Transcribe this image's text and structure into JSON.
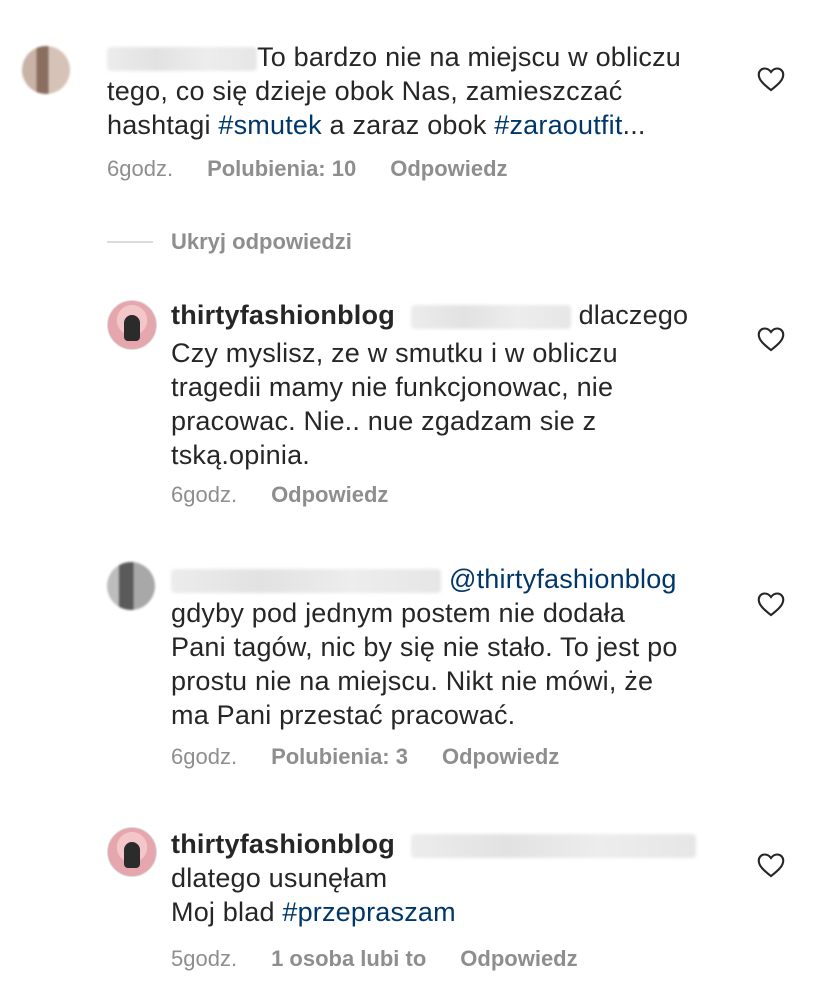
{
  "comments": [
    {
      "line1": "To bardzo nie na miejscu w obliczu",
      "line2": "tego, co się dzieje obok Nas, zamieszczać",
      "line3_prefix": "hashtagi ",
      "hashtag1": "#smutek",
      "line3_mid": " a zaraz obok ",
      "hashtag2": "#zaraoutfit",
      "line3_suffix": "...",
      "time": "6godz.",
      "likes": "Polubienia: 10",
      "reply": "Odpowiedz"
    },
    {
      "username": "thirtyfashionblog",
      "line1_tail": "dlaczego",
      "line2": "Czy myslisz, ze w smutku i w obliczu",
      "line3": "tragedii mamy nie funkcjonowac, nie",
      "line4": "pracowac. Nie.. nue zgadzam sie z",
      "line5": "tską.opinia.",
      "time": "6godz.",
      "reply": "Odpowiedz"
    },
    {
      "mention": "@thirtyfashionblog",
      "line2": "gdyby pod jednym postem nie dodała",
      "line3": "Pani tagów, nic by się nie stało. To jest po",
      "line4": "prostu nie na miejscu. Nikt nie mówi, że",
      "line5": "ma Pani przestać pracować.",
      "time": "6godz.",
      "likes": "Polubienia: 3",
      "reply": "Odpowiedz"
    },
    {
      "username": "thirtyfashionblog",
      "line2": "dlatego usunęłam",
      "line3_prefix": "Moj blad ",
      "hashtag": "#przepraszam",
      "time": "5godz.",
      "likes": "1 osoba lubi to",
      "reply": "Odpowiedz"
    }
  ],
  "hide_replies": "Ukryj odpowiedzi",
  "icons": {
    "heart": "heart-outline-icon"
  },
  "colors": {
    "text": "#262626",
    "meta": "#8e8e8e",
    "link": "#00376b"
  }
}
